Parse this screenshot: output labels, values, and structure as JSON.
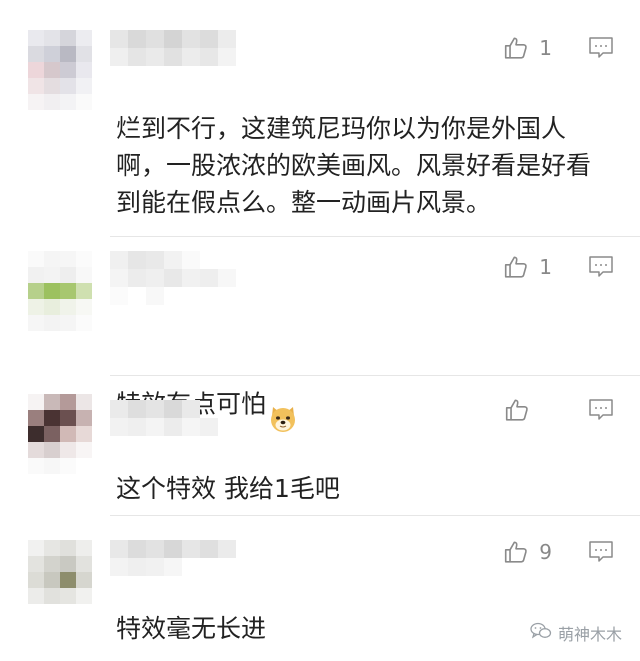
{
  "comments": [
    {
      "likes": "1",
      "text": "烂到不行，这建筑尼玛你以为你是外国人\n啊，一股浓浓的欧美画风。风景好看是好看\n到能在假点么。整一动画片风景。",
      "has_emoji": false
    },
    {
      "likes": "1",
      "text": "特效有点可怕",
      "has_emoji": true,
      "emoji": "doge-emoji"
    },
    {
      "likes": "",
      "text": "这个特效 我给1毛吧",
      "has_emoji": false
    },
    {
      "likes": "9",
      "text": "特效毫无长进",
      "has_emoji": false
    }
  ],
  "icons": {
    "like": "thumbs-up-icon",
    "reply": "comment-icon",
    "watermark": "wechat-icon"
  },
  "watermark": {
    "text": "萌神木木"
  },
  "colors": {
    "icon": "#8a8a8a",
    "text": "#222222",
    "count": "#888888"
  }
}
